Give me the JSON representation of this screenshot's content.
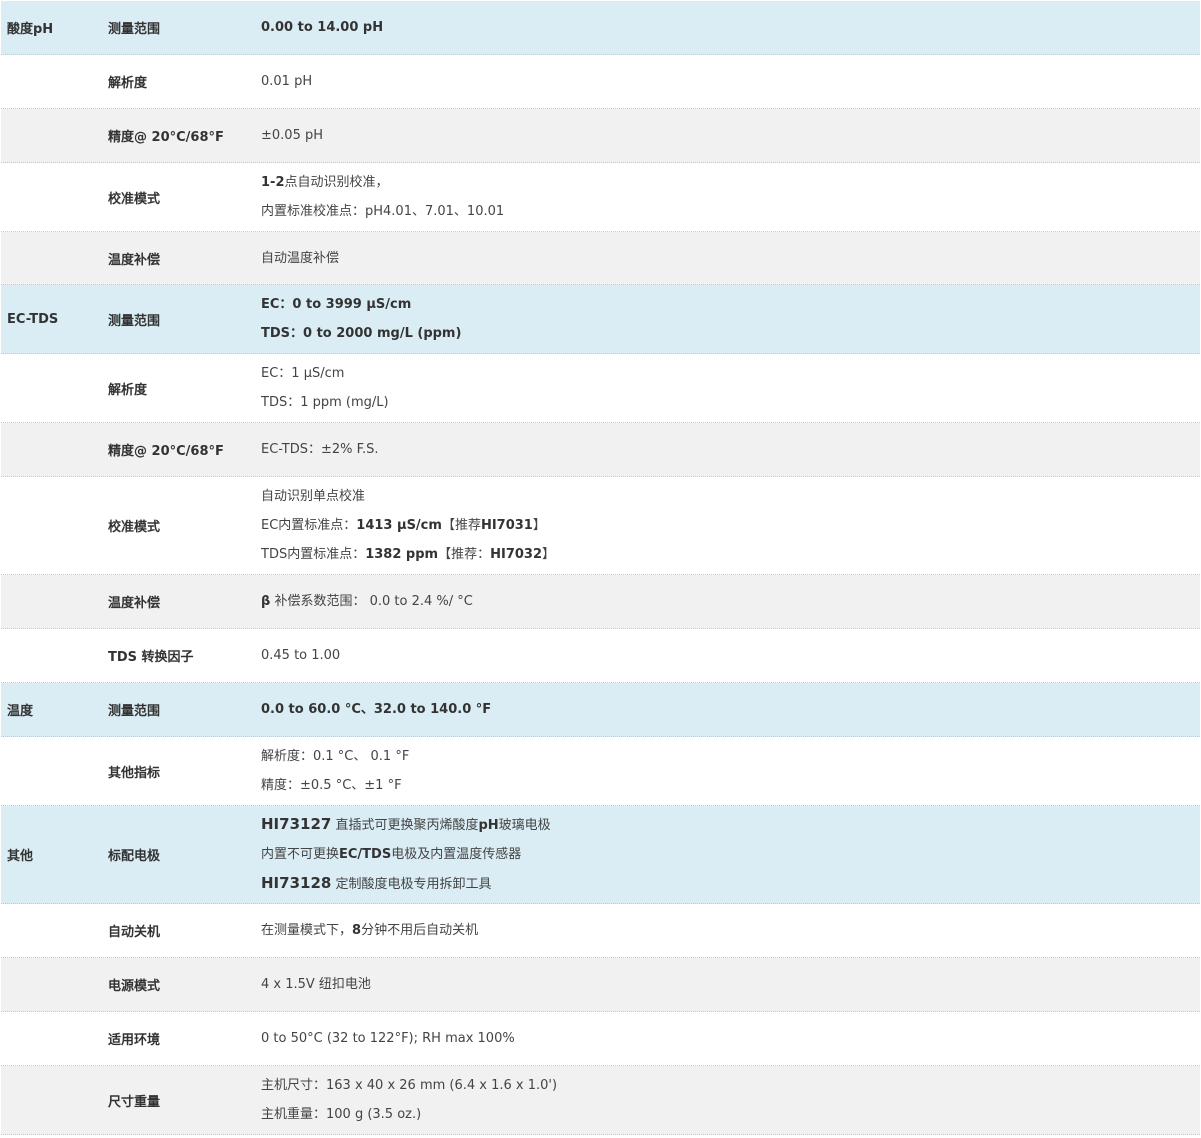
{
  "rows": [
    {
      "category": "酸度pH",
      "param": "测量范围",
      "bg": "blue",
      "h": 54,
      "lines": [
        [
          {
            "t": "0.00 to 14.00 pH",
            "b": true
          }
        ]
      ]
    },
    {
      "category": "",
      "param": "解析度",
      "bg": "white",
      "h": 54,
      "lines": [
        [
          {
            "t": "0.01 pH"
          }
        ]
      ]
    },
    {
      "category": "",
      "param": "精度@ 20°C/68°F",
      "bg": "gray",
      "h": 54,
      "lines": [
        [
          {
            "t": "±0.05 pH"
          }
        ]
      ]
    },
    {
      "category": "",
      "param": "校准模式",
      "bg": "white",
      "h": 69,
      "lines": [
        [
          {
            "t": "1-2",
            "b": true
          },
          {
            "t": "点自动识别校准，"
          }
        ],
        [
          {
            "t": "内置标准校准点：pH4.01、7.01、10.01"
          }
        ]
      ]
    },
    {
      "category": "",
      "param": "温度补偿",
      "bg": "gray",
      "h": 53,
      "lines": [
        [
          {
            "t": "自动温度补偿"
          }
        ]
      ]
    },
    {
      "category": "EC-TDS",
      "param": "测量范围",
      "bg": "blue",
      "h": 69,
      "lines": [
        [
          {
            "t": "EC：0 to 3999 µS/cm",
            "b": true
          }
        ],
        [
          {
            "t": "TDS：0 to 2000 mg/L (ppm)",
            "b": true
          }
        ]
      ]
    },
    {
      "category": "",
      "param": "解析度",
      "bg": "white",
      "h": 69,
      "lines": [
        [
          {
            "t": "EC：1 µS/cm"
          }
        ],
        [
          {
            "t": "TDS：1 ppm (mg/L)"
          }
        ]
      ]
    },
    {
      "category": "",
      "param": "精度@ 20°C/68°F",
      "bg": "gray",
      "h": 54,
      "lines": [
        [
          {
            "t": "EC-TDS：±2% F.S."
          }
        ]
      ]
    },
    {
      "category": "",
      "param": "校准模式",
      "bg": "white",
      "h": 98,
      "lines": [
        [
          {
            "t": "自动识别单点校准"
          }
        ],
        [
          {
            "t": "EC内置标准点："
          },
          {
            "t": "1413 µS/cm",
            "b": true
          },
          {
            "t": "【推荐"
          },
          {
            "t": "HI7031",
            "b": true
          },
          {
            "t": "】"
          }
        ],
        [
          {
            "t": "TDS内置标准点："
          },
          {
            "t": "1382 ppm",
            "b": true
          },
          {
            "t": "【推荐："
          },
          {
            "t": "HI7032",
            "b": true
          },
          {
            "t": "】"
          }
        ]
      ]
    },
    {
      "category": "",
      "param": "温度补偿",
      "bg": "gray",
      "h": 54,
      "lines": [
        [
          {
            "t": "β",
            "b": true
          },
          {
            "t": " 补偿系数范围： 0.0 to 2.4 %/ °C"
          }
        ]
      ]
    },
    {
      "category": "",
      "param": "TDS 转换因子",
      "bg": "white",
      "h": 54,
      "lines": [
        [
          {
            "t": "0.45 to 1.00"
          }
        ]
      ]
    },
    {
      "category": "温度",
      "param": "测量范围",
      "bg": "blue",
      "h": 54,
      "lines": [
        [
          {
            "t": "0.0 to 60.0 °C、32.0 to 140.0 °F",
            "b": true
          }
        ]
      ]
    },
    {
      "category": "",
      "param": "其他指标",
      "bg": "white",
      "h": 69,
      "lines": [
        [
          {
            "t": "解析度：0.1 °C、 0.1 °F"
          }
        ],
        [
          {
            "t": "精度：±0.5 °C、±1 °F"
          }
        ]
      ]
    },
    {
      "category": "其他",
      "param": "标配电极",
      "bg": "blue",
      "h": 98,
      "lines": [
        [
          {
            "t": "HI73127",
            "b": true,
            "big": true
          },
          {
            "t": " 直插式可更换聚丙烯酸度"
          },
          {
            "t": "pH",
            "b": true
          },
          {
            "t": "玻璃电极"
          }
        ],
        [
          {
            "t": "内置不可更换"
          },
          {
            "t": "EC/TDS",
            "b": true
          },
          {
            "t": "电极及内置温度传感器"
          }
        ],
        [
          {
            "t": "HI73128",
            "b": true,
            "big": true
          },
          {
            "t": " 定制酸度电极专用拆卸工具"
          }
        ]
      ]
    },
    {
      "category": "",
      "param": "自动关机",
      "bg": "white",
      "h": 54,
      "lines": [
        [
          {
            "t": "在测量模式下，"
          },
          {
            "t": "8",
            "b": true
          },
          {
            "t": "分钟不用后自动关机"
          }
        ]
      ]
    },
    {
      "category": "",
      "param": "电源模式",
      "bg": "gray",
      "h": 54,
      "lines": [
        [
          {
            "t": "4 x 1.5V 纽扣电池"
          }
        ]
      ]
    },
    {
      "category": "",
      "param": "适用环境",
      "bg": "white",
      "h": 54,
      "lines": [
        [
          {
            "t": "0 to 50°C (32 to 122°F); RH max 100%"
          }
        ]
      ]
    },
    {
      "category": "",
      "param": "尺寸重量",
      "bg": "gray",
      "h": 69,
      "lines": [
        [
          {
            "t": "主机尺寸：163 x 40 x 26 mm (6.4 x 1.6 x 1.0')"
          }
        ],
        [
          {
            "t": "主机重量：100 g (3.5 oz.)"
          }
        ]
      ]
    }
  ]
}
